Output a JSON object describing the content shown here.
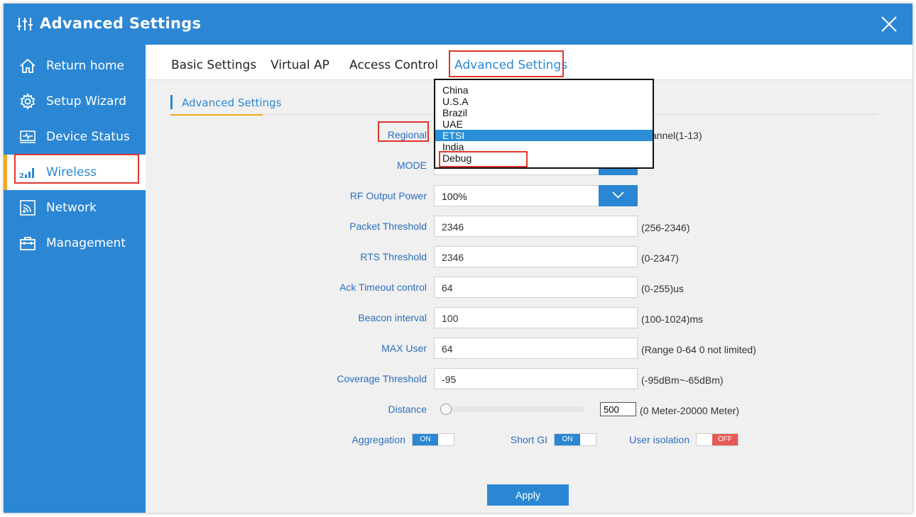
{
  "header": {
    "title": "Advanced Settings",
    "title_icon": "sliders-icon",
    "close_icon": "close-icon",
    "bg_color": "#2b87d4"
  },
  "sidebar": {
    "items": [
      {
        "label": "Return home",
        "icon": "home-icon"
      },
      {
        "label": "Setup Wizard",
        "icon": "gear-icon"
      },
      {
        "label": "Device Status",
        "icon": "monitor-icon"
      },
      {
        "label": "Wireless",
        "icon": "wireless-signal-icon",
        "active": true
      },
      {
        "label": "Network",
        "icon": "network-icon"
      },
      {
        "label": "Management",
        "icon": "toolbox-icon"
      }
    ]
  },
  "tabs": [
    {
      "label": "Basic Settings"
    },
    {
      "label": "Virtual AP"
    },
    {
      "label": "Access Control"
    },
    {
      "label": "Advanced Settings",
      "active": true
    }
  ],
  "section_title": "Advanced Settings",
  "form": {
    "regional": {
      "label": "Regional",
      "hint": "annel(1-13)"
    },
    "mode": {
      "label": "MODE"
    },
    "rf_output_power": {
      "label": "RF Output Power",
      "value": "100%"
    },
    "packet_threshold": {
      "label": "Packet Threshold",
      "value": "2346",
      "hint": "(256-2346)"
    },
    "rts_threshold": {
      "label": "RTS Threshold",
      "value": "2346",
      "hint": "(0-2347)"
    },
    "ack_timeout": {
      "label": "Ack Timeout control",
      "value": "64",
      "hint": "(0-255)us"
    },
    "beacon_interval": {
      "label": "Beacon interval",
      "value": "100",
      "hint": "(100-1024)ms"
    },
    "max_user": {
      "label": "MAX User",
      "value": "64",
      "hint": "(Range 0-64 0 not limited)"
    },
    "coverage_threshold": {
      "label": "Coverage Threshold",
      "value": "-95",
      "hint": "(-95dBm~-65dBm)"
    },
    "distance": {
      "label": "Distance",
      "value": "500",
      "hint": "(0 Meter-20000 Meter)"
    },
    "aggregation": {
      "label": "Aggregation",
      "state": "ON"
    },
    "short_gi": {
      "label": "Short GI",
      "state": "ON"
    },
    "user_isolation": {
      "label": "User isolation",
      "state": "OFF"
    }
  },
  "regional_dropdown": {
    "options": [
      "China",
      "U.S.A",
      "Brazil",
      "UAE",
      "ETSI",
      "India",
      "Debug"
    ],
    "selected": "ETSI"
  },
  "apply_label": "Apply",
  "colors": {
    "accent": "#2b87d4",
    "highlight": "#e0352d",
    "active_indicator": "#f0a81e",
    "off_toggle": "#e55a56"
  }
}
